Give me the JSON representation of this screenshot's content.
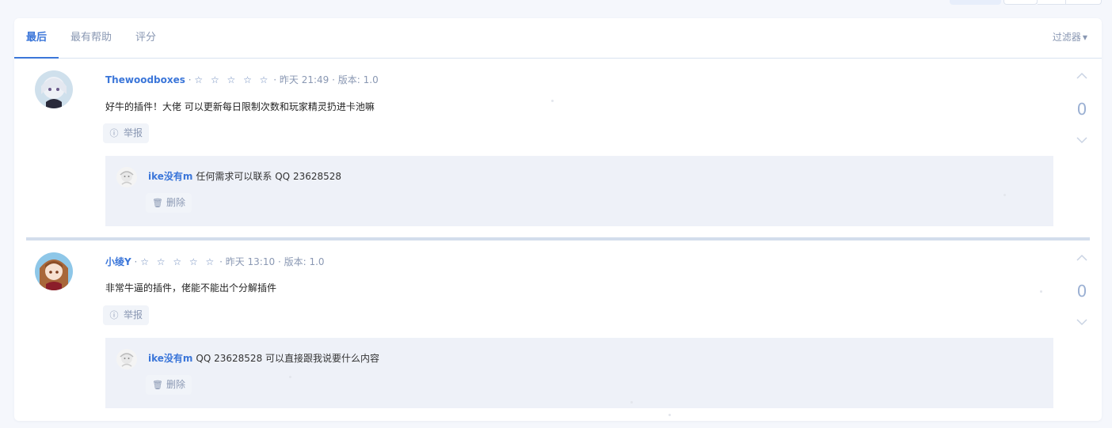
{
  "tabs": [
    {
      "label": "最后"
    },
    {
      "label": "最有帮助"
    },
    {
      "label": "评分"
    }
  ],
  "filter_label": "过滤器",
  "reviews": [
    {
      "author": "Thewoodboxes",
      "stars": "☆ ☆ ☆ ☆ ☆",
      "time": "昨天 21:49",
      "version": "版本: 1.0",
      "content": "好牛的插件！大佬 可以更新每日限制次数和玩家精灵扔进卡池嘛",
      "report_label": "举报",
      "votes": "0",
      "reply": {
        "author": "ike没有m",
        "text": "任何需求可以联系 QQ 23628528",
        "delete_label": "删除"
      }
    },
    {
      "author": "小绫Y",
      "stars": "☆ ☆ ☆ ☆ ☆",
      "time": "昨天 13:10",
      "version": "版本: 1.0",
      "content": "非常牛逼的插件，佬能不能出个分解插件",
      "report_label": "举报",
      "votes": "0",
      "reply": {
        "author": "ike没有m",
        "text": "QQ 23628528 可以直接跟我说要什么内容",
        "delete_label": "删除"
      }
    }
  ],
  "separator": "·",
  "colors": {
    "accent": "#3b76d9",
    "muted": "#8a98b3",
    "reply_bg": "#eef1f8"
  }
}
